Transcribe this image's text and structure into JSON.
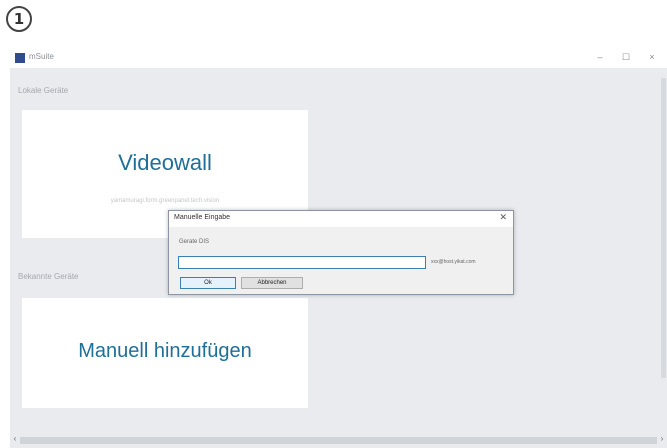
{
  "step_badge": "1",
  "window": {
    "title": "mSuite",
    "icon": "app-icon",
    "controls": {
      "minimize": "–",
      "maximize": "☐",
      "close": "×"
    }
  },
  "sections": {
    "local_devices": "Lokale Geräte",
    "known_devices": "Bekannte Geräte"
  },
  "tiles": {
    "videowall": {
      "title": "Videowall",
      "subtitle": "yamamuragi.form.greenpanel.tech.vision"
    },
    "manual_add": {
      "title": "Manuell hinzufügen"
    }
  },
  "dialog": {
    "title": "Manuelle Eingabe",
    "close": "✕",
    "field_label": "Gerate DIS",
    "input_value": "",
    "hint": "xxx@host.yikat.com",
    "ok_label": "Ok",
    "cancel_label": "Abbrechen"
  },
  "scrollbar": {
    "left_arrow": "‹",
    "right_arrow": "›"
  }
}
